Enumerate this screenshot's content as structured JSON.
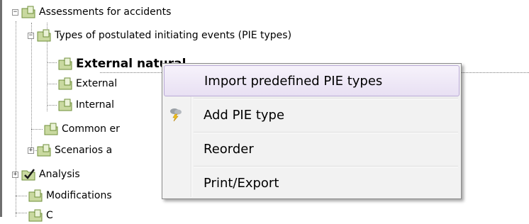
{
  "tree": {
    "items": [
      {
        "label": "Assessments for accidents",
        "icon": "folder-book-icon",
        "expander": "-"
      },
      {
        "label": "Types of postulated initiating events (PIE types)",
        "icon": "folder-book-icon",
        "expander": "-"
      },
      {
        "label": "External natural",
        "icon": "folder-book-icon",
        "selected": true
      },
      {
        "label": "External",
        "icon": "folder-book-icon"
      },
      {
        "label": "Internal",
        "icon": "folder-book-icon"
      },
      {
        "label": "Common er",
        "icon": "folder-book-icon"
      },
      {
        "label": "Scenarios a",
        "icon": "folder-book-icon",
        "expander": "+"
      },
      {
        "label": "Analysis",
        "icon": "folder-check-icon",
        "expander": "+"
      },
      {
        "label": "Modifications",
        "icon": "folder-book-icon"
      },
      {
        "label": "C",
        "icon": "folder-book-icon"
      }
    ]
  },
  "context_menu": {
    "items": [
      {
        "label": "Import predefined PIE types",
        "icon": "",
        "highlighted": true
      },
      {
        "label": "Add PIE type",
        "icon": "storm-cloud-icon"
      },
      {
        "label": "Reorder",
        "icon": ""
      },
      {
        "label": "Print/Export",
        "icon": ""
      }
    ]
  },
  "colors": {
    "folder": "#c9d9a0",
    "folder_dark": "#6f8f3a",
    "highlight_border": "#b9a9d6",
    "menu_bg": "#f2f2f2"
  }
}
